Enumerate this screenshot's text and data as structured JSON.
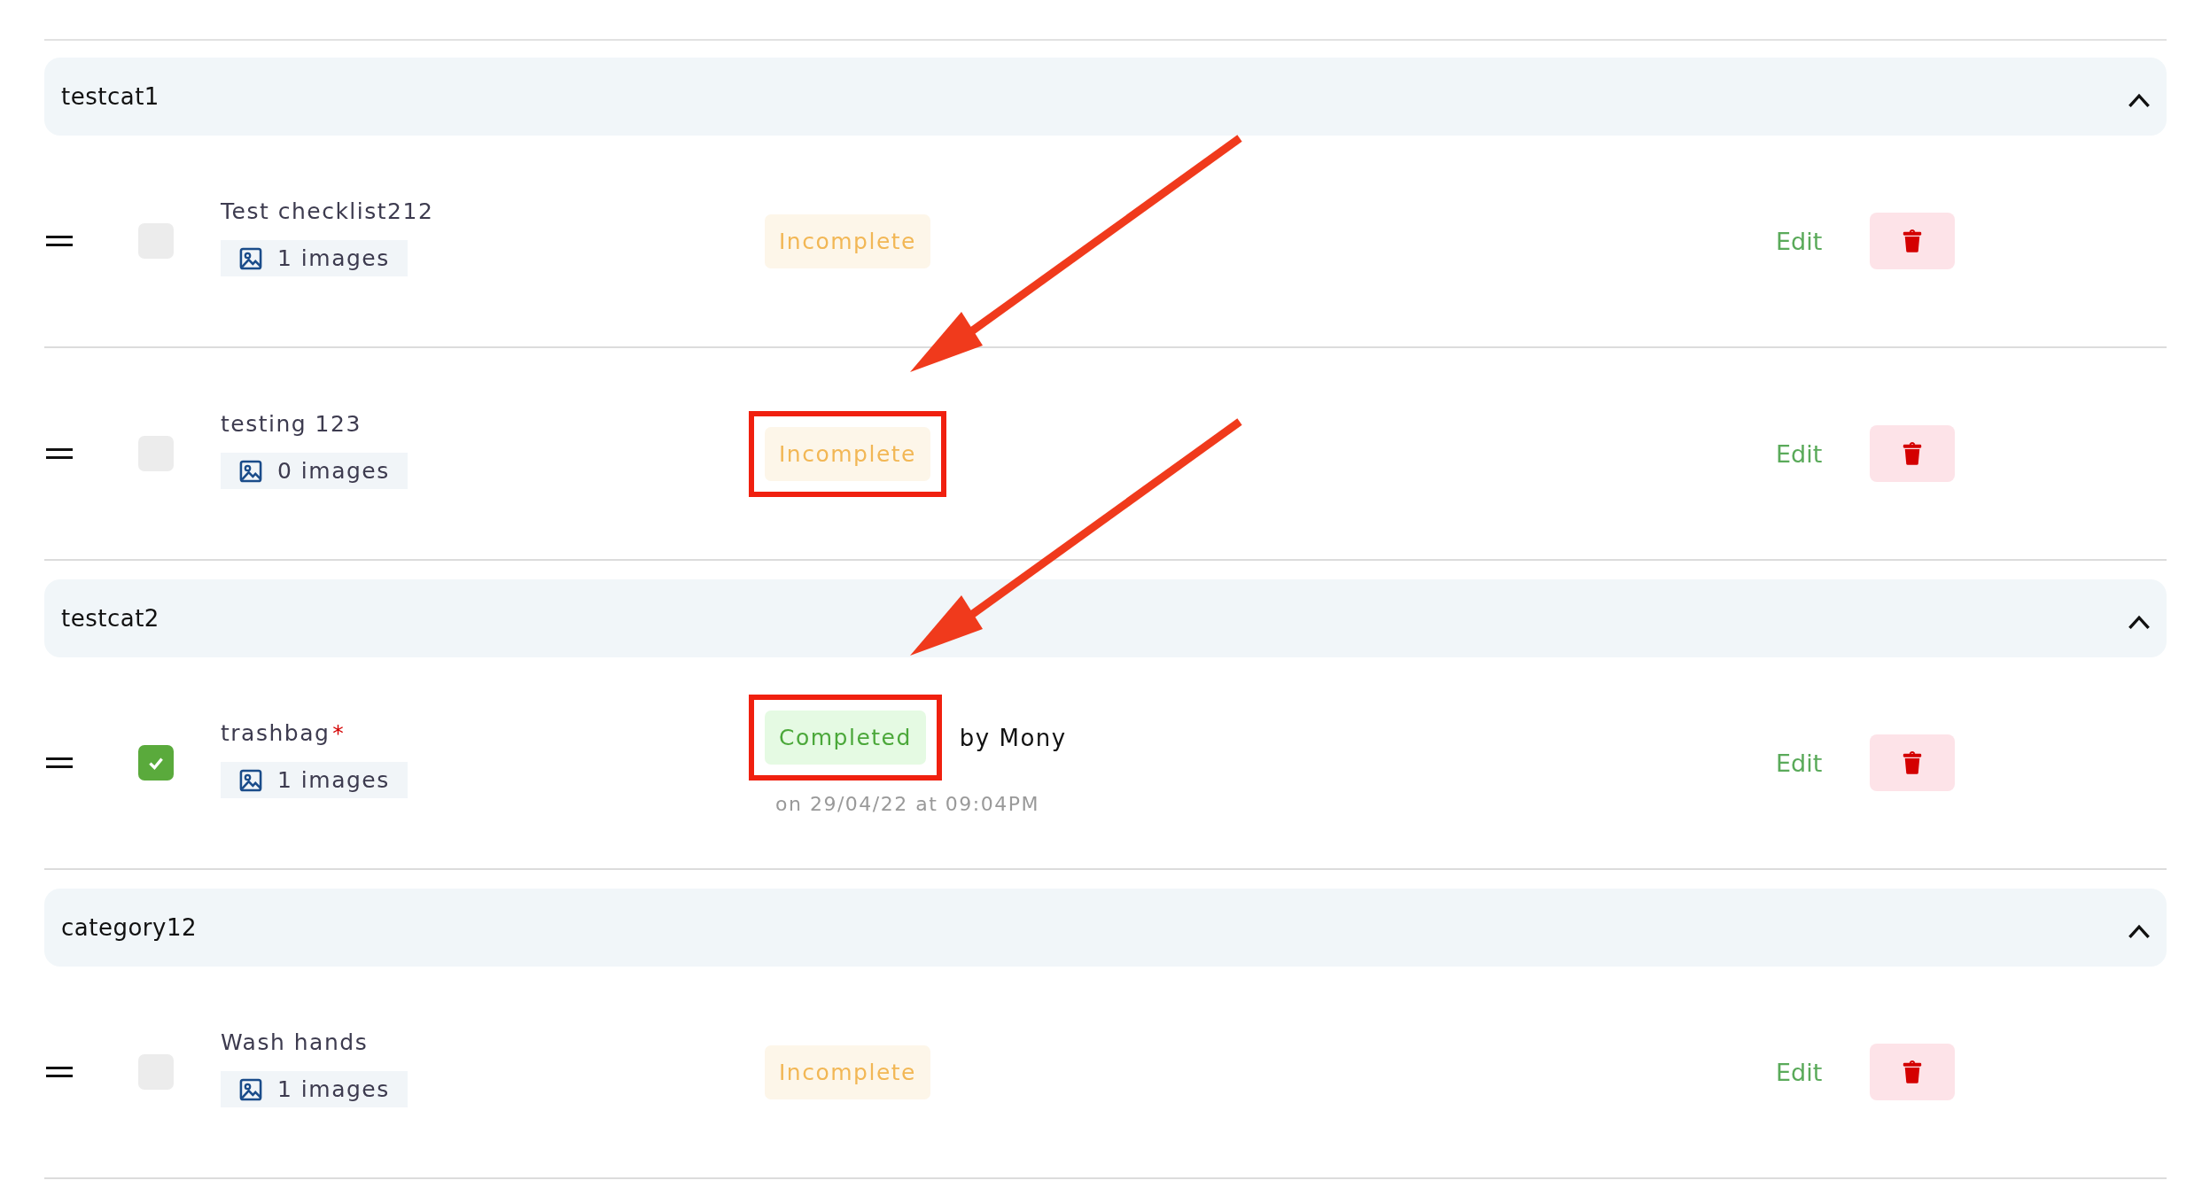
{
  "categories": [
    {
      "name": "testcat1",
      "expanded": true,
      "items": [
        {
          "title": "Test checklist212",
          "checked": false,
          "images": "1 images",
          "status": {
            "kind": "incomplete",
            "label": "Incomplete"
          },
          "highlighted": false,
          "edit": "Edit"
        },
        {
          "title": "testing 123",
          "checked": false,
          "images": "0 images",
          "status": {
            "kind": "incomplete",
            "label": "Incomplete"
          },
          "highlighted": true,
          "edit": "Edit"
        }
      ]
    },
    {
      "name": "testcat2",
      "expanded": true,
      "items": [
        {
          "title": "trashbag",
          "required_mark": "*",
          "checked": true,
          "images": "1 images",
          "status": {
            "kind": "completed",
            "label": "Completed",
            "by": "by Mony",
            "when": "on 29/04/22 at 09:04PM"
          },
          "highlighted": true,
          "edit": "Edit"
        }
      ]
    },
    {
      "name": "category12",
      "expanded": true,
      "items": [
        {
          "title": "Wash hands",
          "checked": false,
          "images": "1 images",
          "status": {
            "kind": "incomplete",
            "label": "Incomplete"
          },
          "highlighted": false,
          "edit": "Edit"
        }
      ]
    }
  ]
}
